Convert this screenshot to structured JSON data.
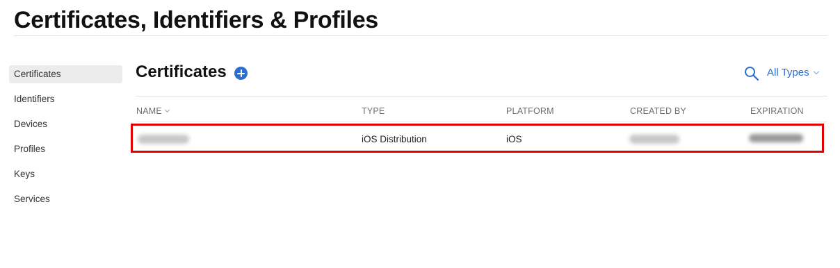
{
  "header": {
    "title": "Certificates, Identifiers & Profiles"
  },
  "sidebar": {
    "items": [
      {
        "label": "Certificates",
        "active": true
      },
      {
        "label": "Identifiers",
        "active": false
      },
      {
        "label": "Devices",
        "active": false
      },
      {
        "label": "Profiles",
        "active": false
      },
      {
        "label": "Keys",
        "active": false
      },
      {
        "label": "Services",
        "active": false
      }
    ]
  },
  "main": {
    "section_title": "Certificates",
    "add_icon": "plus-circle-icon",
    "search_icon": "magnifying-glass-icon",
    "filter_label": "All Types",
    "accent_color": "#2a6ecf",
    "highlight_color": "#e00000",
    "columns": {
      "name": "NAME",
      "type": "TYPE",
      "platform": "PLATFORM",
      "created_by": "CREATED BY",
      "expiration": "EXPIRATION"
    },
    "rows": [
      {
        "type": "iOS Distribution",
        "platform": "iOS"
      }
    ]
  }
}
